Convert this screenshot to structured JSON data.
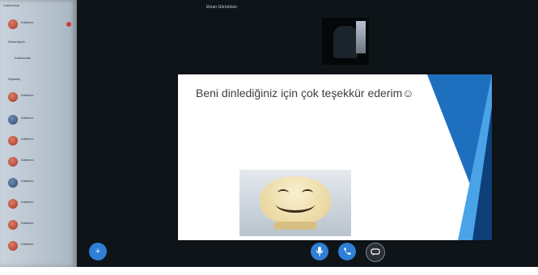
{
  "top_bar": {
    "title": "Ekran Görüntüsü"
  },
  "sidebar": {
    "heading": "Katılımcılar",
    "items": [
      {
        "name": "Katılımcı",
        "sub": "",
        "badge": true
      },
      {
        "name": "Düzenleyici",
        "sub": ""
      },
      {
        "name": "Katılımcılar",
        "sub": ""
      },
      {
        "name": "Ziyaretçi",
        "sub": ""
      },
      {
        "name": "Katılımcı",
        "sub": ""
      },
      {
        "name": "Katılımcı",
        "sub": ""
      },
      {
        "name": "Katılımcı",
        "sub": ""
      },
      {
        "name": "Katılımcı",
        "sub": ""
      },
      {
        "name": "Katılımcı",
        "sub": ""
      },
      {
        "name": "Katılımcı",
        "sub": ""
      },
      {
        "name": "Katılımcı",
        "sub": ""
      },
      {
        "name": "Katılımcı",
        "sub": ""
      }
    ]
  },
  "camera": {
    "label": ""
  },
  "slide": {
    "title": "Beni dinlediğiniz için çok teşekkür ederim☺",
    "bullet": ""
  },
  "controls": {
    "add_icon": "+",
    "mic_icon": "mic",
    "end_icon": "call-end",
    "chat_icon": "chat"
  }
}
